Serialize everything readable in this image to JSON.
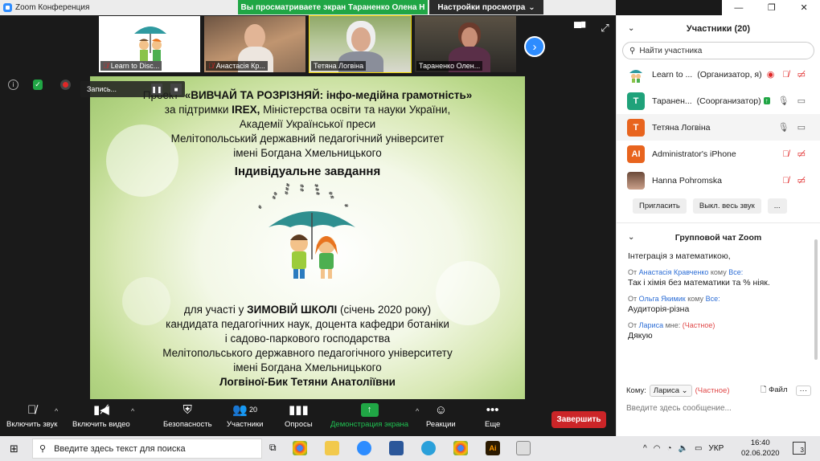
{
  "window": {
    "title": "Zoom Конференция",
    "share_banner": "Вы просматриваете экран Тараненко Олена Н",
    "view_settings": "Настройки просмотра"
  },
  "thumbnails": [
    {
      "name": "Learn to Disc...",
      "muted": true
    },
    {
      "name": "Анастасія Кр...",
      "muted": true
    },
    {
      "name": "Тетяна Логвіна",
      "muted": false
    },
    {
      "name": "Тараненко Олен...",
      "muted": false
    }
  ],
  "recording": {
    "label": "Запись..."
  },
  "slide": {
    "line1_prefix": "Проект",
    "line1_title": "«ВИВЧАЙ ТА РОЗРІЗНЯЙ: інфо-медійна грамотність»",
    "line2_prefix": "за підтримки",
    "line2_bold": "IREX,",
    "line2_rest": "Міністерства освіти та науки України,",
    "line3": "Академії Української преси",
    "line4": "Мелітопольський державний педагогічний університет",
    "line5": "імені Богдана Хмельницького",
    "heading": "Індивідуальне завдання",
    "line6_prefix": "для участі у",
    "line6_bold": "ЗИМОВІЙ ШКОЛІ",
    "line6_rest": "(січень 2020 року)",
    "line7": "кандидата педагогічних наук, доцента кафедри ботаніки",
    "line8": "і садово-паркового господарства",
    "line9": "Мелітопольського державного педагогічного університету",
    "line10": "імені Богдана Хмельницького",
    "line11": "Логвіної-Бик Тетяни Анатоліївни"
  },
  "toolbar": {
    "mute": "Включить звук",
    "video": "Включить видео",
    "security": "Безопасность",
    "participants": "Участники",
    "participants_count": "20",
    "polls": "Опросы",
    "share": "Демонстрация экрана",
    "reactions": "Реакции",
    "more": "Еще",
    "end": "Завершить"
  },
  "participants": {
    "title": "Участники (20)",
    "search_placeholder": "Найти участника",
    "list": [
      {
        "name": "Learn to ...",
        "role": "(Организатор, я)",
        "avatar_letter": "",
        "avatar_color": "#ffffff"
      },
      {
        "name": "Таранен...",
        "role": "(Соорганизатор)",
        "avatar_letter": "T",
        "avatar_color": "#1fa27a"
      },
      {
        "name": "Тетяна Логвіна",
        "role": "",
        "avatar_letter": "T",
        "avatar_color": "#e8641e"
      },
      {
        "name": "Administrator's iPhone",
        "role": "",
        "avatar_letter": "AI",
        "avatar_color": "#e8641e"
      },
      {
        "name": "Hanna Pohromska",
        "role": "",
        "avatar_letter": "",
        "avatar_color": "#8a6a55"
      }
    ],
    "invite": "Пригласить",
    "mute_all": "Выкл. весь звук",
    "more": "..."
  },
  "chat": {
    "title": "Групповой чат Zoom",
    "partial_top": "Інтеграція з математикою,",
    "messages": [
      {
        "from_prefix": "От",
        "from": "Анастасія Кравченко",
        "to_prefix": "кому",
        "to": "Все:",
        "private": false,
        "text": "Так і хімія без математики та % нiяк."
      },
      {
        "from_prefix": "От",
        "from": "Ольга Якимик",
        "to_prefix": "кому",
        "to": "Все:",
        "private": false,
        "text": "Аудиторія-різна"
      },
      {
        "from_prefix": "От",
        "from": "Лариса",
        "to_prefix": "мне:",
        "to": "(Частное)",
        "private": true,
        "text": "Дякую"
      }
    ],
    "to_label": "Кому:",
    "to_value": "Лариса",
    "to_private": "(Частное)",
    "file": "Файл",
    "input_placeholder": "Введите здесь сообщение..."
  },
  "taskbar": {
    "search_placeholder": "Введите здесь текст для поиска",
    "lang": "УКР",
    "time": "16:40",
    "date": "02.06.2020",
    "notifications": "3"
  }
}
